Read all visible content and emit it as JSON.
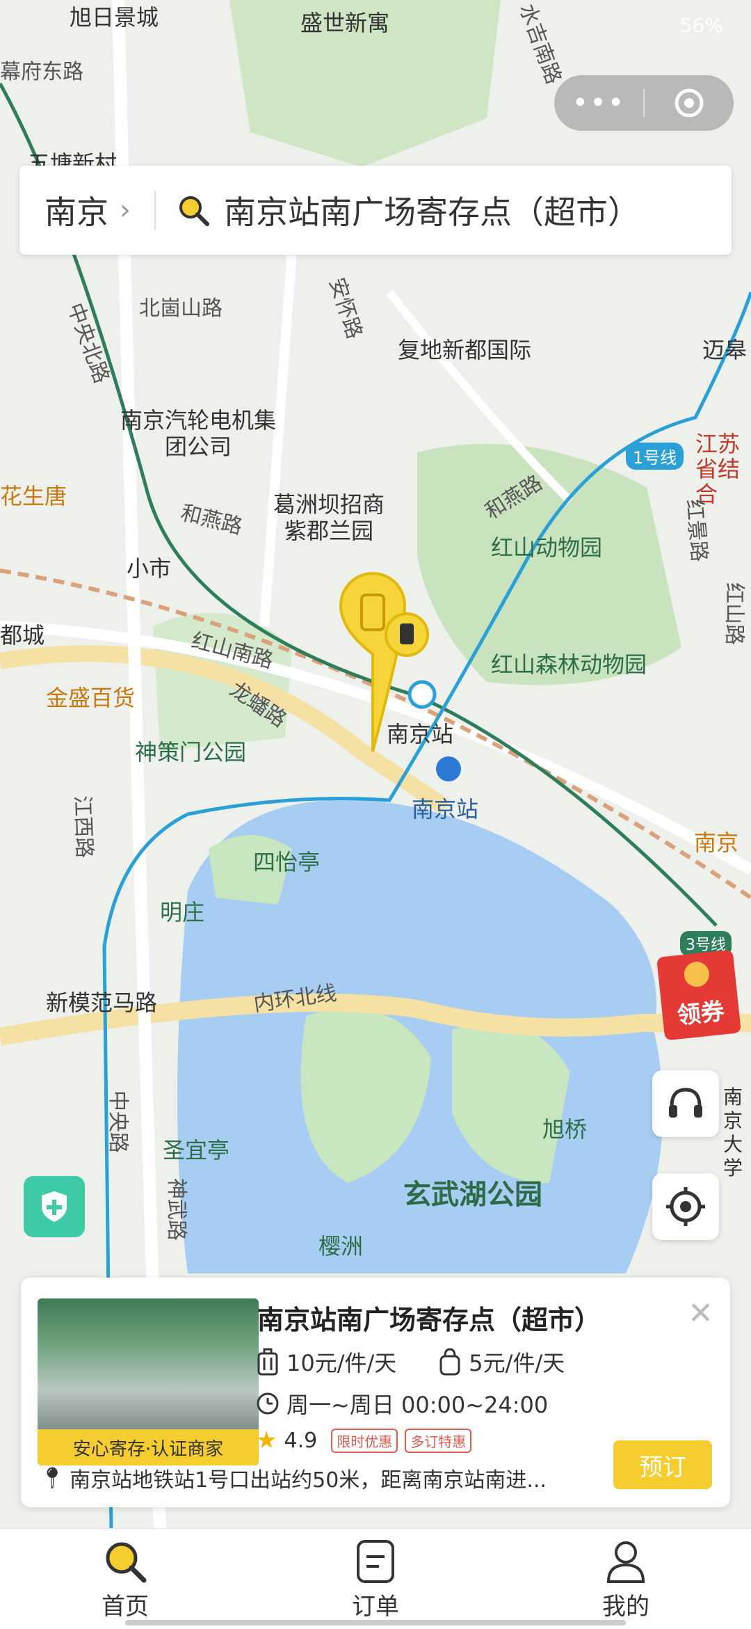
{
  "status": {
    "battery": "56%"
  },
  "search": {
    "city": "南京",
    "query": "南京站南广场寄存点（超市）"
  },
  "map": {
    "labels": [
      "旭日景城",
      "盛世新寓",
      "幕府东路",
      "五塘新村",
      "水吉南路",
      "北崮山路",
      "安怀路",
      "复地新都国际",
      "迈皋",
      "中央北路",
      "南京汽轮电机集团公司",
      "花生唐",
      "江苏省结合",
      "1号线",
      "葛洲坝招商紫郡兰园",
      "和燕路",
      "和燕路",
      "红山动物园",
      "红景路",
      "小市",
      "红山森林动物园",
      "都城",
      "红山南路",
      "金盛百货",
      "龙蟠路",
      "南京站",
      "神策门公园",
      "南京站",
      "江西路",
      "四怡亭",
      "南京",
      "明庄",
      "3号线",
      "新模范马路",
      "内环北线",
      "中央路",
      "旭桥",
      "南京大学",
      "圣宜亭",
      "神武路",
      "玄武湖公园",
      "樱洲",
      "红山路"
    ]
  },
  "coupon": {
    "label": "领券"
  },
  "store": {
    "name": "南京站南广场寄存点（超市）",
    "thumb_tag": "安心寄存·认证商家",
    "price_large": "10元/件/天",
    "price_small": "5元/件/天",
    "hours": "周一~周日 00:00~24:00",
    "rating": "4.9",
    "badge1": "限时优惠",
    "badge2": "多订特惠",
    "address": "南京站地铁站1号口出站约50米，距离南京站南进...",
    "book_label": "预订"
  },
  "nav": {
    "home": "首页",
    "orders": "订单",
    "mine": "我的"
  },
  "colors": {
    "accent": "#f5cd2e",
    "teal": "#3ec9a7",
    "red": "#e53935"
  }
}
